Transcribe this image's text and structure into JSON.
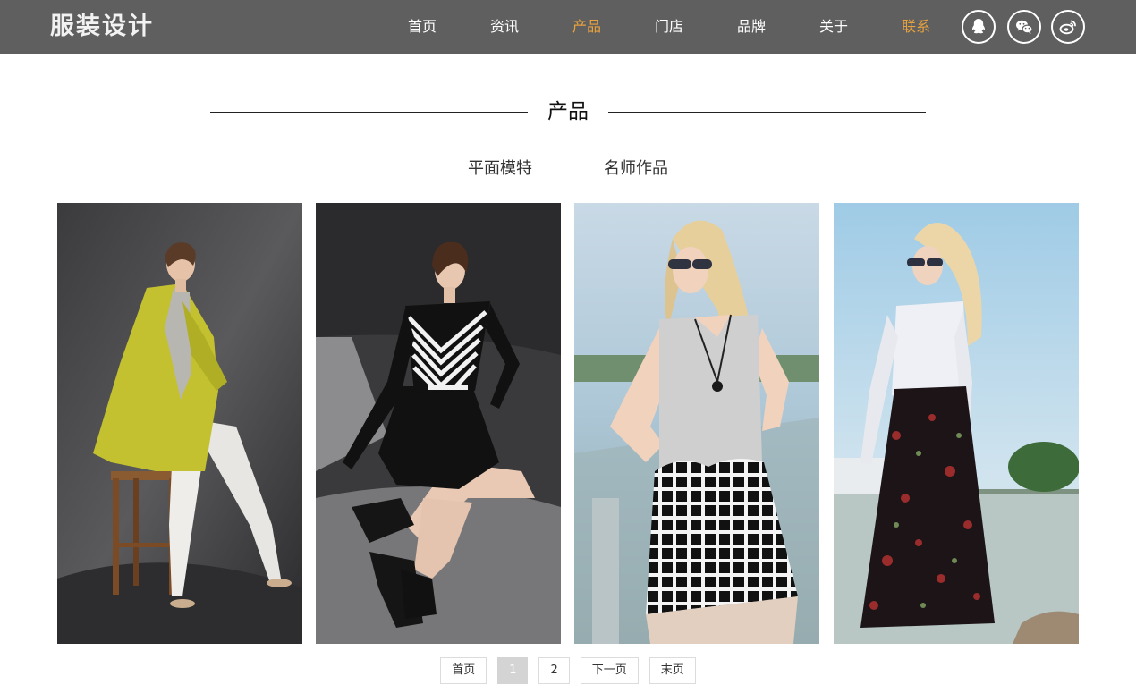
{
  "header": {
    "logo": "服装设计",
    "nav": [
      {
        "label": "首页",
        "highlight": false
      },
      {
        "label": "资讯",
        "highlight": false
      },
      {
        "label": "产品",
        "highlight": true
      },
      {
        "label": "门店",
        "highlight": false
      },
      {
        "label": "品牌",
        "highlight": false
      },
      {
        "label": "关于",
        "highlight": false
      },
      {
        "label": "联系",
        "highlight": true
      }
    ],
    "social_icons": [
      "qq-icon",
      "wechat-icon",
      "weibo-icon"
    ]
  },
  "section": {
    "title": "产品",
    "subtabs": [
      "平面模特",
      "名师作品"
    ]
  },
  "gallery": {
    "items": [
      {
        "image": "model-yellow-coat"
      },
      {
        "image": "model-striped-dress"
      },
      {
        "image": "model-checkered-dress"
      },
      {
        "image": "model-floral-skirt"
      }
    ]
  },
  "pagination": {
    "first": "首页",
    "pages": [
      "1",
      "2"
    ],
    "current": "1",
    "next": "下一页",
    "last": "末页"
  },
  "colors": {
    "header_bg": "#5f5f5f",
    "accent": "#e8a23e",
    "active_page": "#d4d4d4"
  }
}
